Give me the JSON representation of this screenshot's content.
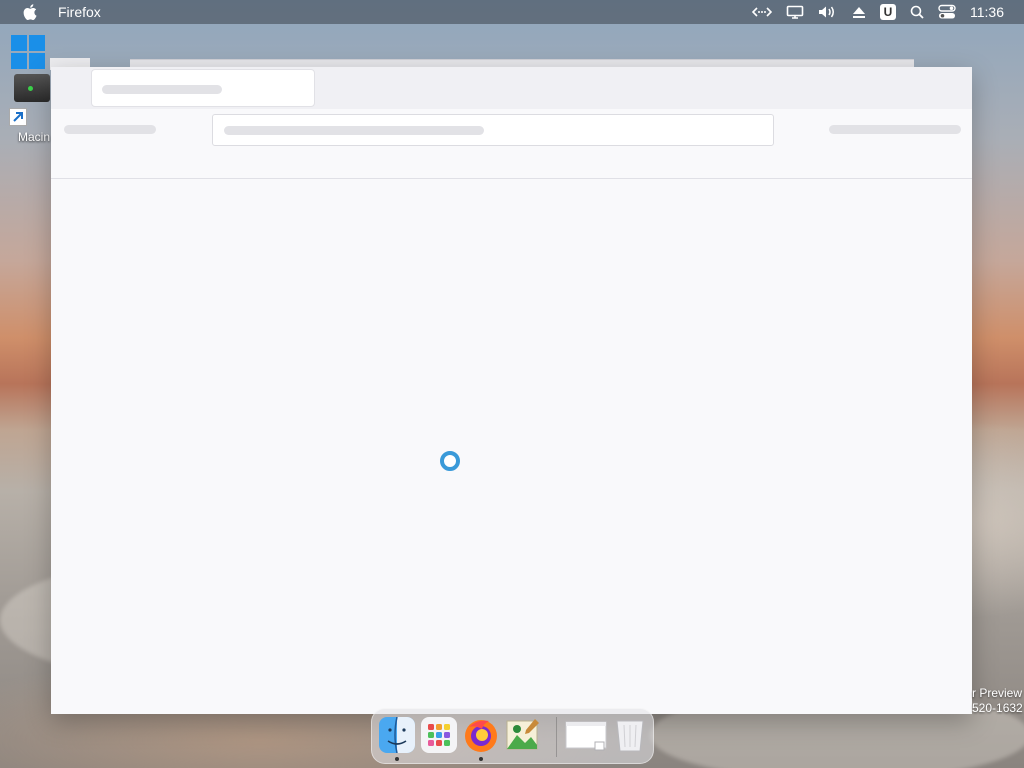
{
  "menubar": {
    "app_name": "Firefox",
    "clock": "11:36",
    "status_badge": "U"
  },
  "desktop": {
    "drive_label": "Macin"
  },
  "watermark": {
    "line1": "r Preview",
    "line2": "520-1632"
  },
  "browser": {
    "state": "loading"
  },
  "dock": {
    "items": [
      "finder-icon",
      "launchpad-icon",
      "firefox-icon",
      "image-editor-icon",
      "window-preview-icon",
      "trash-icon"
    ]
  },
  "colors": {
    "spinner": "#3a9ad9",
    "window_bg": "#f9f9fb",
    "tabstrip_bg": "#f0f0f4"
  }
}
